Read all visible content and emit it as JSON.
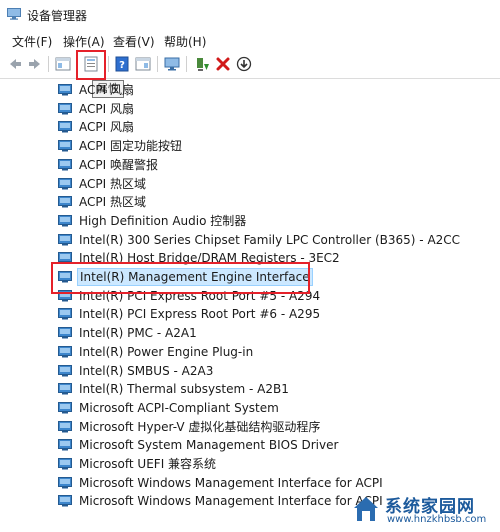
{
  "window": {
    "title": "设备管理器"
  },
  "menu": [
    {
      "label": "文件(F)"
    },
    {
      "label": "操作(A)"
    },
    {
      "label": "查看(V)"
    },
    {
      "label": "帮助(H)"
    }
  ],
  "toolbar": {
    "buttons": [
      {
        "name": "back-button",
        "icon": "arrow-left-icon"
      },
      {
        "name": "forward-button",
        "icon": "arrow-right-icon"
      },
      {
        "name": "show-hide-console-tree-button",
        "icon": "console-tree-icon"
      },
      {
        "name": "properties-button",
        "icon": "properties-icon"
      },
      {
        "name": "help-button",
        "icon": "help-icon"
      },
      {
        "name": "show-hide-action-pane-button",
        "icon": "action-pane-icon"
      },
      {
        "name": "scan-hardware-button",
        "icon": "monitor-icon"
      },
      {
        "name": "update-driver-button",
        "icon": "update-driver-icon"
      },
      {
        "name": "uninstall-device-button",
        "icon": "delete-x-icon"
      },
      {
        "name": "disable-device-button",
        "icon": "download-arrow-icon"
      }
    ],
    "tooltip": "属性"
  },
  "devices": [
    {
      "label": "ACPI 风扇"
    },
    {
      "label": "ACPI 风扇"
    },
    {
      "label": "ACPI 风扇"
    },
    {
      "label": "ACPI 固定功能按钮"
    },
    {
      "label": "ACPI 唤醒警报"
    },
    {
      "label": "ACPI 热区域"
    },
    {
      "label": "ACPI 热区域"
    },
    {
      "label": "High Definition Audio 控制器"
    },
    {
      "label": "Intel(R) 300 Series Chipset Family LPC Controller (B365) - A2CC"
    },
    {
      "label": "Intel(R) Host Bridge/DRAM Registers - 3EC2"
    },
    {
      "label": "Intel(R) Management Engine Interface",
      "selected": true
    },
    {
      "label": "Intel(R) PCI Express Root Port #5 - A294"
    },
    {
      "label": "Intel(R) PCI Express Root Port #6 - A295"
    },
    {
      "label": "Intel(R) PMC - A2A1"
    },
    {
      "label": "Intel(R) Power Engine Plug-in"
    },
    {
      "label": "Intel(R) SMBUS - A2A3"
    },
    {
      "label": "Intel(R) Thermal subsystem - A2B1"
    },
    {
      "label": "Microsoft ACPI-Compliant System"
    },
    {
      "label": "Microsoft Hyper-V 虚拟化基础结构驱动程序"
    },
    {
      "label": "Microsoft System Management BIOS Driver"
    },
    {
      "label": "Microsoft UEFI 兼容系统"
    },
    {
      "label": "Microsoft Windows Management Interface for ACPI"
    },
    {
      "label": "Microsoft Windows Management Interface for ACPI"
    }
  ],
  "watermark": {
    "name": "系统家园网",
    "url": "www.hnzkhbsb.com"
  },
  "colors": {
    "highlight": "#e5212a",
    "selection": "#cce8ff",
    "device_icon": "#2e7bc4"
  }
}
